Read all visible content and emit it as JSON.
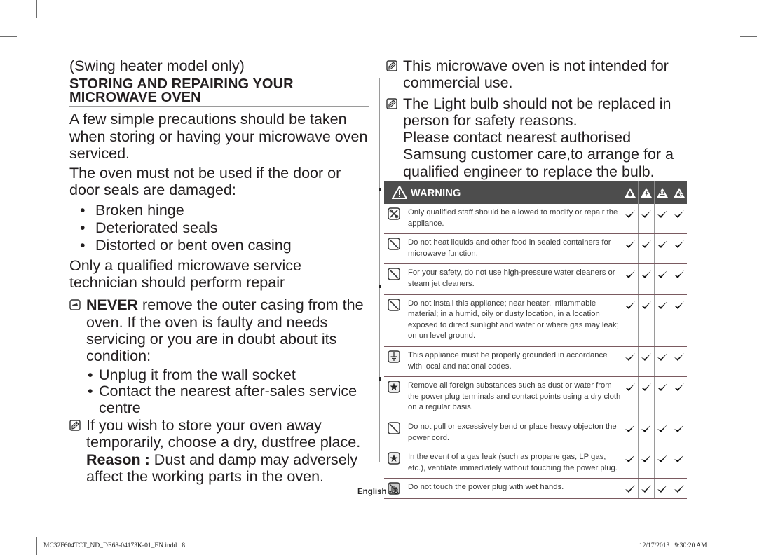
{
  "left_column": {
    "subtitle": "(Swing heater model only)",
    "section_title_line1": "STORING AND REPAIRING YOUR",
    "section_title_line2": "MICROWAVE OVEN",
    "intro": "A few simple precautions should be taken when storing or having your microwave oven serviced.",
    "door_warning": "The oven must not be used if the door or door seals are damaged:",
    "damage_list": [
      "Broken hinge",
      "Deteriorated seals",
      "Distorted or bent oven casing"
    ],
    "technician_note": "Only a qualified microwave service technician should perform repair",
    "never_bold": "NEVER",
    "never_text": " remove the outer casing from the oven. If the oven is faulty and needs servicing or you are in doubt about its condition:",
    "action_list": [
      "Unplug it from the wall socket",
      "Contact the nearest after-sales service centre"
    ],
    "storage_note": "If you wish to store your oven away temporarily, choose a dry, dustfree place.",
    "reason_bold": "Reason :",
    "reason_text": " Dust and damp may adversely affect the working parts in the oven."
  },
  "right_column": {
    "note1": "This microwave oven is not intended for commercial use.",
    "note2": "The Light bulb should not be replaced in person for safety reasons.",
    "note2_cont": "Please contact nearest authorised Samsung customer care,to arrange for a qualified engineer to replace the bulb."
  },
  "warning_table": {
    "title": "WARNING",
    "header_icons": [
      "fire-hazard-icon",
      "electric-shock-icon",
      "heat-hazard-icon",
      "explosion-hazard-icon"
    ],
    "check_symbol": "✔",
    "rows": [
      {
        "icon": "no-disassembly-icon",
        "text": "Only qualified staff should be allowed to modify or repair the appliance.",
        "checks": [
          true,
          true,
          true,
          true
        ]
      },
      {
        "icon": "prohibited-icon",
        "text": "Do not heat liquids and other food in sealed containers for microwave function.",
        "checks": [
          true,
          true,
          true,
          true
        ]
      },
      {
        "icon": "prohibited-icon",
        "text": "For your safety, do not use high-pressure water cleaners or steam jet cleaners.",
        "checks": [
          true,
          true,
          true,
          true
        ]
      },
      {
        "icon": "prohibited-icon",
        "text": "Do not install this appliance; near heater, inflammable material; in a humid, oily or dusty location, in a location exposed to direct sunlight and water or where gas may leak; on un level ground.",
        "checks": [
          true,
          true,
          true,
          true
        ]
      },
      {
        "icon": "ground-icon",
        "text": "This appliance must be properly grounded in accordance with local and national codes.",
        "checks": [
          true,
          true,
          true,
          true
        ]
      },
      {
        "icon": "star-icon",
        "text": "Remove all foreign substances such as dust or water from the power plug terminals and contact points using a dry cloth on a regular basis.",
        "checks": [
          true,
          true,
          true,
          true
        ]
      },
      {
        "icon": "prohibited-icon",
        "text": "Do not pull or excessively bend or place heavy objecton the power cord.",
        "checks": [
          true,
          true,
          true,
          true
        ]
      },
      {
        "icon": "star-icon",
        "text": "In the event of a gas leak (such as propane gas, LP gas, etc.), ventilate immediately without touching the power plug.",
        "checks": [
          true,
          true,
          true,
          true
        ]
      },
      {
        "icon": "no-wet-hands-icon",
        "text": "Do not touch the power plug with wet hands.",
        "checks": [
          true,
          true,
          true,
          true
        ]
      }
    ]
  },
  "footer": {
    "page_label": "English - 8",
    "slug_file": "MC32F604TCT_ND_DE68-04173K-01_EN.indd   8",
    "slug_date": "12/17/2013   9:30:20 AM"
  }
}
